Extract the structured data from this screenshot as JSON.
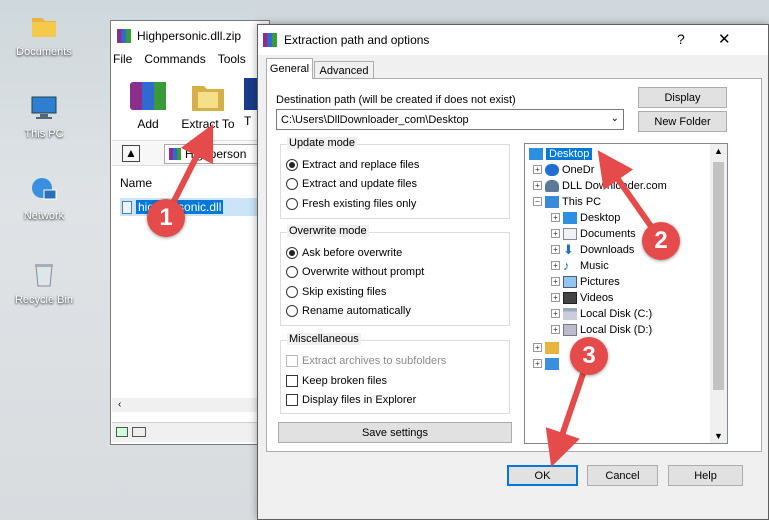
{
  "desktop": {
    "icons": [
      {
        "label": "Documents"
      },
      {
        "label": "This PC"
      },
      {
        "label": "Network"
      },
      {
        "label": "Recycle Bin"
      }
    ]
  },
  "winrar": {
    "title": "Highpersonic.dll.zip",
    "menu": [
      "File",
      "Commands",
      "Tools"
    ],
    "toolbar": {
      "add": "Add",
      "extract_to": "Extract To",
      "third": "T"
    },
    "path_label": "Highperson",
    "column_name": "Name",
    "file_name": "highpersonic.dll"
  },
  "dialog": {
    "title": "Extraction path and options",
    "help_glyph": "?",
    "close_glyph": "✕",
    "tabs": {
      "general": "General",
      "advanced": "Advanced"
    },
    "dest_label": "Destination path (will be created if does not exist)",
    "dest_value": "C:\\Users\\DllDownloader_com\\Desktop",
    "display_btn": "Display",
    "new_folder_btn": "New Folder",
    "update_mode": {
      "label": "Update mode",
      "options": [
        "Extract and replace files",
        "Extract and update files",
        "Fresh existing files only"
      ],
      "selected": 0
    },
    "overwrite_mode": {
      "label": "Overwrite mode",
      "options": [
        "Ask before overwrite",
        "Overwrite without prompt",
        "Skip existing files",
        "Rename automatically"
      ],
      "selected": 0
    },
    "misc": {
      "label": "Miscellaneous",
      "extract_sub": "Extract archives to subfolders",
      "keep_broken": "Keep broken files",
      "display_explorer": "Display files in Explorer"
    },
    "save_settings": "Save settings",
    "tree": {
      "desktop": "Desktop",
      "onedrive": "OneDr",
      "dll": "DLL Downloader.com",
      "thispc": "This PC",
      "pc_desktop": "Desktop",
      "documents": "Documents",
      "downloads": "Downloads",
      "music": "Music",
      "pictures": "Pictures",
      "videos": "Videos",
      "local_c": "Local Disk (C:)",
      "local_d": "Local Disk (D:)"
    },
    "ok": "OK",
    "cancel": "Cancel",
    "help": "Help"
  },
  "annotations": {
    "n1": "1",
    "n2": "2",
    "n3": "3"
  },
  "colors": {
    "arrow": "#e54b4b",
    "select": "#0078d7"
  }
}
